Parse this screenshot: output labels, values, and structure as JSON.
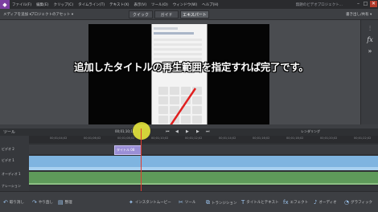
{
  "menubar": {
    "logo": "◆",
    "items": [
      "ファイル(F)",
      "編集(E)",
      "クリップ(C)",
      "タイムライン(T)",
      "テキスト(X)",
      "表示(V)",
      "ツール(O)",
      "ウィンドウ(W)",
      "ヘルプ(H)"
    ],
    "project_name": "無題のビデオプロジェクト...",
    "min": "–",
    "max": "□",
    "close": "✕"
  },
  "modebar": {
    "media_add": "メディアを追加 ▾",
    "project_assets": "プロジェクトのアセット ▾",
    "tabs": [
      "クイック",
      "ガイド",
      "エキスパート"
    ],
    "right_label": "書き出し/共有 ▾"
  },
  "callout": "追加したタイトルの再生範囲を指定すれば完了です。",
  "right_panel": {
    "adjust": "⫶",
    "fx": "fx",
    "more": "»"
  },
  "transport": {
    "timecode": "00;01;10;12",
    "rewind": "⏮",
    "step_back": "◀",
    "play": "▶",
    "step_fwd": "▶",
    "end": "⏭",
    "render": "レンダリング",
    "left_label": "ツール"
  },
  "ruler": {
    "ticks": [
      "00;01;04;02",
      "00;01;06;02",
      "00;01;08;02",
      "00;01;10;02",
      "00;01;12;02",
      "00;01;14;02",
      "00;01;16;02",
      "00;01;18;02",
      "00;01;20;02",
      "00;01;22;02"
    ]
  },
  "tracks": {
    "video2": "ビデオ 2",
    "video1": "ビデオ 1",
    "audio1": "オーディオ 1",
    "narration": "ナレーション",
    "title_clip": "タイトル 08"
  },
  "bottombar": {
    "undo": "取り消し",
    "redo": "やり直し",
    "organizer": "整理",
    "instant_movie": "インスタントムービー",
    "tools": "ツール",
    "transitions": "トランジション",
    "titles": "タイトルとテキスト",
    "effects": "エフェクト",
    "audio": "オーディオ",
    "graphics": "グラフィック"
  },
  "colors": {
    "accent": "#7b3fa0",
    "playhead": "#e23b2e",
    "title_clip": "#9b8fd6",
    "video_track": "#7fb4e0",
    "audio_track": "#5e9a5a"
  }
}
